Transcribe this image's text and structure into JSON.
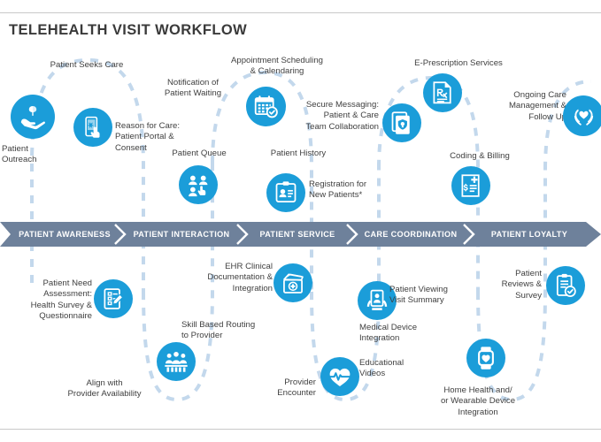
{
  "page": {
    "title": "TELEHEALTH VISIT WORKFLOW",
    "accent_blue": "#1b9dd9",
    "banner_color": "#6e819b",
    "wave_color": "#c3d8ec",
    "rule_color": "#c9c9c9",
    "text_color": "#3f3f3f"
  },
  "banner": {
    "phases": [
      {
        "label": "PATIENT AWARENESS"
      },
      {
        "label": "PATIENT INTERACTION"
      },
      {
        "label": "PATIENT SERVICE"
      },
      {
        "label": "CARE COORDINATION"
      },
      {
        "label": "PATIENT LOYALTY"
      }
    ]
  },
  "nodes": {
    "top": [
      {
        "label": "Patient Seeks Care",
        "icon": "none"
      },
      {
        "label": "Patient\nOutreach",
        "icon": "hand-sprout-icon"
      },
      {
        "label": "Reason for Care:\nPatient Portal &\nConsent",
        "icon": "mobile-tap-icon"
      },
      {
        "label": "Notification of\nPatient Waiting",
        "icon": "none"
      },
      {
        "label": "Patient Queue",
        "icon": "people-queue-icon"
      },
      {
        "label": "Appointment  Scheduling\n& Calendaring",
        "icon": "calendar-check-icon"
      },
      {
        "label": "Patient History",
        "icon": "none"
      },
      {
        "label": "Registration for\nNew Patients*",
        "icon": "id-clipboard-icon"
      },
      {
        "label": "Secure Messaging:\nPatient & Care\nTeam Collaboration",
        "icon": "secure-message-icon"
      },
      {
        "label": "E-Prescription Services",
        "icon": "prescription-icon"
      },
      {
        "label": "Coding & Billing",
        "icon": "billing-invoice-icon"
      },
      {
        "label": "Ongoing Care\nManagement &\nFollow Up",
        "icon": "hands-heart-icon"
      }
    ],
    "bottom": [
      {
        "label": "Patient Need\nAssessment:\nHealth Survey &\nQuestionnaire",
        "icon": "survey-checklist-icon"
      },
      {
        "label": "Align with\nProvider Availability",
        "icon": "none"
      },
      {
        "label": "Skill Based Routing\nto Provider",
        "icon": "none"
      },
      {
        "label": "EHR Clinical\nDocumentation &\nIntegration",
        "icon": "medical-records-icon"
      },
      {
        "label": "Provider\nEncounter",
        "icon": "heartbeat-icon"
      },
      {
        "label": "Patient Viewing\nVisit Summary",
        "icon": "tablet-viewing-icon"
      },
      {
        "label": "Medical Device\nIntegration",
        "icon": "none"
      },
      {
        "label": "Educational\nVideos",
        "icon": "none"
      },
      {
        "label": "Home Health and/\nor Wearable Device\nIntegration",
        "icon": "smartwatch-heart-icon"
      },
      {
        "label": "Patient\nReviews &\nSurvey",
        "icon": "review-clipboard-icon"
      }
    ],
    "group_icons": {
      "routing_people": "group-people-icon"
    }
  },
  "labels": {
    "routing_group": "group-people-icon"
  }
}
